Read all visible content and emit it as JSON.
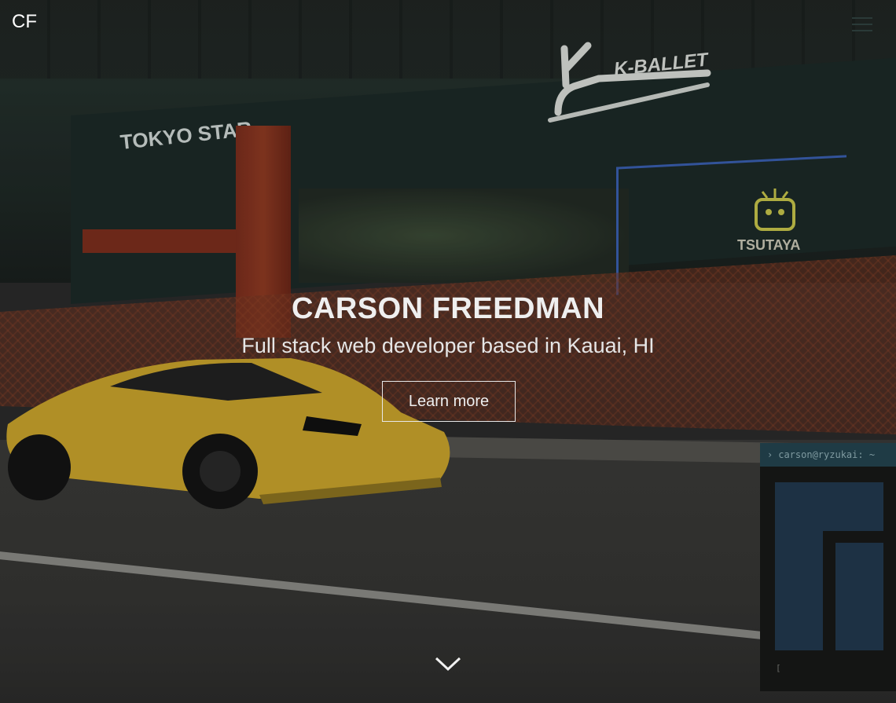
{
  "header": {
    "logo_text": "CF",
    "menu_icon": "hamburger-menu-icon"
  },
  "hero": {
    "title": "CARSON FREEDMAN",
    "subtitle": "Full stack web developer based in Kauai, HI",
    "cta_label": "Learn more",
    "scroll_icon": "chevron-down-icon"
  },
  "background_signs": {
    "k_ballet": "K-BALLET",
    "tokyo_star": "TOKYO STAR",
    "tsutaya": "TSUTAYA"
  },
  "terminal": {
    "prompt_icon": "chevron-right-icon",
    "title": "carson@ryzukai: ~",
    "cursor_text": "[",
    "colors": {
      "bar": "#1f3b45",
      "tile": "#1d3144",
      "body": "#141514"
    }
  },
  "colors": {
    "text": "#efefef",
    "car": "#c9a32c"
  }
}
